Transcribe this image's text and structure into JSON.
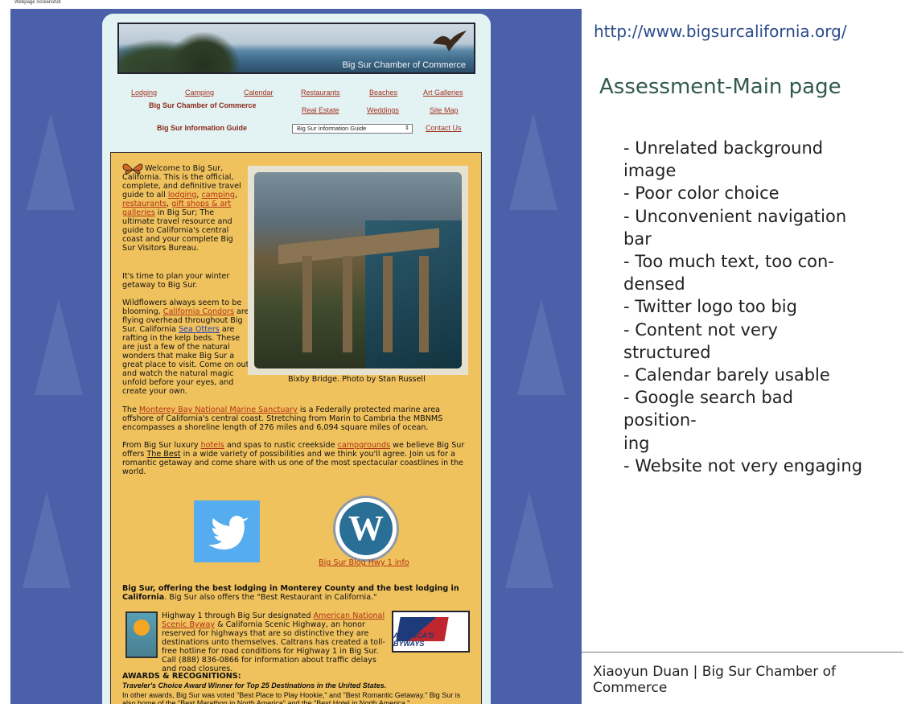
{
  "caption": "Webpage Screenshot",
  "site": {
    "banner_title": "Big Sur Chamber of Commerce",
    "nav_row1": [
      "Lodging",
      "Camping",
      "Calendar",
      "Restaurants",
      "Beaches",
      "Art Galleries"
    ],
    "nav_label1": "Big Sur Chamber of Commerce",
    "nav_row2": [
      "Real Estate",
      "Weddings",
      "Site Map"
    ],
    "nav_label2": "Big Sur Information Guide",
    "select_value": "Big Sur Information Guide",
    "contact": "Contact Us",
    "welcome": {
      "p1_a": "Welcome to Big Sur, California. This is the official, complete, and definitive travel guide to all",
      "link_lodging": "lodging",
      "link_camping": "camping",
      "link_restaurants": "restaurants",
      "link_gift": "gift shops & art galleries",
      "p1_b": "in Big Sur; The ultimate travel resource and guide to California's central coast and your complete Big Sur Visitors Bureau.",
      "p2": "It's time to plan your winter getaway to Big Sur.",
      "p3_a": "Wildflowers always seem to be blooming,",
      "link_condors": "California Condors",
      "p3_b": "are flying overhead throughout Big Sur. California",
      "link_otters": "Sea Otters",
      "p3_c": "are rafting in the kelp beds. These are just a few of the natural wonders that make Big Sur a great place to visit. Come on out and watch the natural magic unfold before your eyes, and create your own."
    },
    "photo_caption": "Bixby Bridge. Photo by Stan Russell",
    "p4_a": "The",
    "link_monterey": "Monterey Bay National Marine Sanctuary",
    "p4_b": "is a Federally protected marine area offshore of California's central coast. Stretching from Marin to Cambria the MBNMS encompasses a shoreline length of 276 miles and 6,094 square miles of ocean.",
    "p5_a": "From Big Sur luxury",
    "link_hotels": "hotels",
    "p5_b": "and spas to rustic creekside",
    "link_campgrounds": "campgrounds",
    "p5_c": "we believe Big Sur offers",
    "link_thebest": "The Best",
    "p5_d": "in a wide variety of possibilities and we think you'll agree. Join us for a romantic getaway and come share with us one of the most spectacular coastlines in the world.",
    "blog_link": "Big Sur Blog Hwy 1 info",
    "p6_bold": "Big Sur, offering the best lodging in Monterey County and the best lodging in California",
    "p6_rest": ". Big Sur also offers the \"Best Restaurant in California.\"",
    "p7_a": "Highway 1 through Big Sur designated",
    "link_byway": "American National Scenic Byway",
    "p7_b": "& California Scenic Highway, an honor reserved for highways that are so distinctive they are destinations unto themselves. Caltrans has created a toll-free hotline for road conditions for Highway 1 in Big Sur. Call (888) 836-0866 for information about traffic delays and road closures.",
    "byways_text": "AMERICA'S BYWAYS",
    "awards_title": "AWARDS & RECOGNITIONS:",
    "awards_italic": "Traveler's Choice Award Winner for Top 25 Destinations in the United States.",
    "awards_text": "In other awards, Big Sur was voted \"Best Place to Play Hookie,\" and \"Best Romantic Getaway.\" Big Sur is also home of the \"Best Marathon in North America\" and the \"Best Hotel in North America.\""
  },
  "slide": {
    "url": "http://www.bigsurcalifornia.org/",
    "heading": "Assessment-Main page",
    "bullets": [
      "- Unrelated background image",
      "- Poor color choice",
      "- Unconvenient navigation bar",
      "- Too much text, too con-",
      "densed",
      "- Twitter logo too big",
      "- Content not very structured",
      "- Calendar barely usable",
      "- Google search bad position-",
      "ing",
      "- Website not very engaging"
    ],
    "footer": "Xiaoyun Duan | Big Sur Chamber of Commerce"
  },
  "colors": {
    "background_blue": "#4a60a8",
    "content_yellow": "#f0c25e",
    "link_red": "#b23214",
    "heading_green": "#325a4e"
  }
}
